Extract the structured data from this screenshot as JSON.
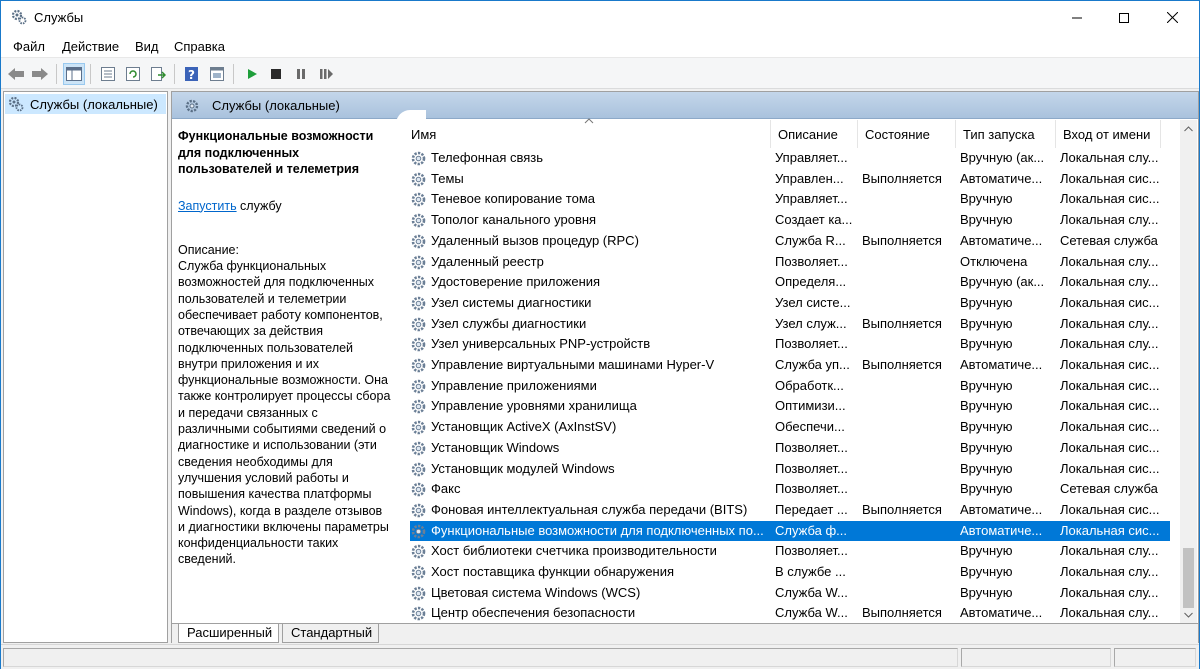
{
  "window": {
    "title": "Службы"
  },
  "menu": [
    "Файл",
    "Действие",
    "Вид",
    "Справка"
  ],
  "tree": {
    "root_label": "Службы (локальные)"
  },
  "panel": {
    "header": "Службы (локальные)"
  },
  "details": {
    "title": "Функциональные возможности для подключенных пользователей и телеметрия",
    "action_link": "Запустить",
    "action_suffix": " службу",
    "description_label": "Описание:",
    "description": "Служба функциональных возможностей для подключенных пользователей и телеметрии обеспечивает работу компонентов, отвечающих за действия подключенных пользователей внутри приложения и их функциональные возможности. Она также контролирует процессы сбора и передачи связанных с различными событиями сведений о диагностике и использовании (эти сведения необходимы для улучшения условий работы и повышения качества платформы Windows), когда в разделе отзывов и диагностики включены параметры конфиденциальности таких сведений."
  },
  "columns": [
    "Имя",
    "Описание",
    "Состояние",
    "Тип запуска",
    "Вход от имени"
  ],
  "services": [
    {
      "name": "Телефонная связь",
      "desc": "Управляет...",
      "status": "",
      "startup": "Вручную (ак...",
      "logon": "Локальная слу..."
    },
    {
      "name": "Темы",
      "desc": "Управлен...",
      "status": "Выполняется",
      "startup": "Автоматиче...",
      "logon": "Локальная сис..."
    },
    {
      "name": "Теневое копирование тома",
      "desc": "Управляет...",
      "status": "",
      "startup": "Вручную",
      "logon": "Локальная сис..."
    },
    {
      "name": "Тополог канального уровня",
      "desc": "Создает ка...",
      "status": "",
      "startup": "Вручную",
      "logon": "Локальная слу..."
    },
    {
      "name": "Удаленный вызов процедур (RPC)",
      "desc": "Служба R...",
      "status": "Выполняется",
      "startup": "Автоматиче...",
      "logon": "Сетевая служба"
    },
    {
      "name": "Удаленный реестр",
      "desc": "Позволяет...",
      "status": "",
      "startup": "Отключена",
      "logon": "Локальная слу..."
    },
    {
      "name": "Удостоверение приложения",
      "desc": "Определя...",
      "status": "",
      "startup": "Вручную (ак...",
      "logon": "Локальная слу..."
    },
    {
      "name": "Узел системы диагностики",
      "desc": "Узел систе...",
      "status": "",
      "startup": "Вручную",
      "logon": "Локальная сис..."
    },
    {
      "name": "Узел службы диагностики",
      "desc": "Узел служ...",
      "status": "Выполняется",
      "startup": "Вручную",
      "logon": "Локальная слу..."
    },
    {
      "name": "Узел универсальных PNP-устройств",
      "desc": "Позволяет...",
      "status": "",
      "startup": "Вручную",
      "logon": "Локальная слу..."
    },
    {
      "name": "Управление виртуальными машинами Hyper-V",
      "desc": "Служба уп...",
      "status": "Выполняется",
      "startup": "Автоматиче...",
      "logon": "Локальная сис..."
    },
    {
      "name": "Управление приложениями",
      "desc": "Обработк...",
      "status": "",
      "startup": "Вручную",
      "logon": "Локальная сис..."
    },
    {
      "name": "Управление уровнями хранилища",
      "desc": "Оптимизи...",
      "status": "",
      "startup": "Вручную",
      "logon": "Локальная сис..."
    },
    {
      "name": "Установщик ActiveX (AxInstSV)",
      "desc": "Обеспечи...",
      "status": "",
      "startup": "Вручную",
      "logon": "Локальная сис..."
    },
    {
      "name": "Установщик Windows",
      "desc": "Позволяет...",
      "status": "",
      "startup": "Вручную",
      "logon": "Локальная сис..."
    },
    {
      "name": "Установщик модулей Windows",
      "desc": "Позволяет...",
      "status": "",
      "startup": "Вручную",
      "logon": "Локальная сис..."
    },
    {
      "name": "Факс",
      "desc": "Позволяет...",
      "status": "",
      "startup": "Вручную",
      "logon": "Сетевая служба"
    },
    {
      "name": "Фоновая интеллектуальная служба передачи (BITS)",
      "desc": "Передает ...",
      "status": "Выполняется",
      "startup": "Автоматиче...",
      "logon": "Локальная сис..."
    },
    {
      "name": "Функциональные возможности для подключенных по...",
      "desc": "Служба ф...",
      "status": "",
      "startup": "Автоматиче...",
      "logon": "Локальная сис..."
    },
    {
      "name": "Хост библиотеки счетчика производительности",
      "desc": "Позволяет...",
      "status": "",
      "startup": "Вручную",
      "logon": "Локальная слу..."
    },
    {
      "name": "Хост поставщика функции обнаружения",
      "desc": "В службе ...",
      "status": "",
      "startup": "Вручную",
      "logon": "Локальная слу..."
    },
    {
      "name": "Цветовая система Windows (WCS)",
      "desc": "Служба W...",
      "status": "",
      "startup": "Вручную",
      "logon": "Локальная слу..."
    },
    {
      "name": "Центр обеспечения безопасности",
      "desc": "Служба W...",
      "status": "Выполняется",
      "startup": "Автоматиче...",
      "logon": "Локальная слу..."
    }
  ],
  "selected_index": 18,
  "tabs": [
    "Расширенный",
    "Стандартный"
  ],
  "colors": {
    "selection": "#0078d7",
    "link": "#0066cc",
    "header_gradient": "#b3c9e2"
  }
}
